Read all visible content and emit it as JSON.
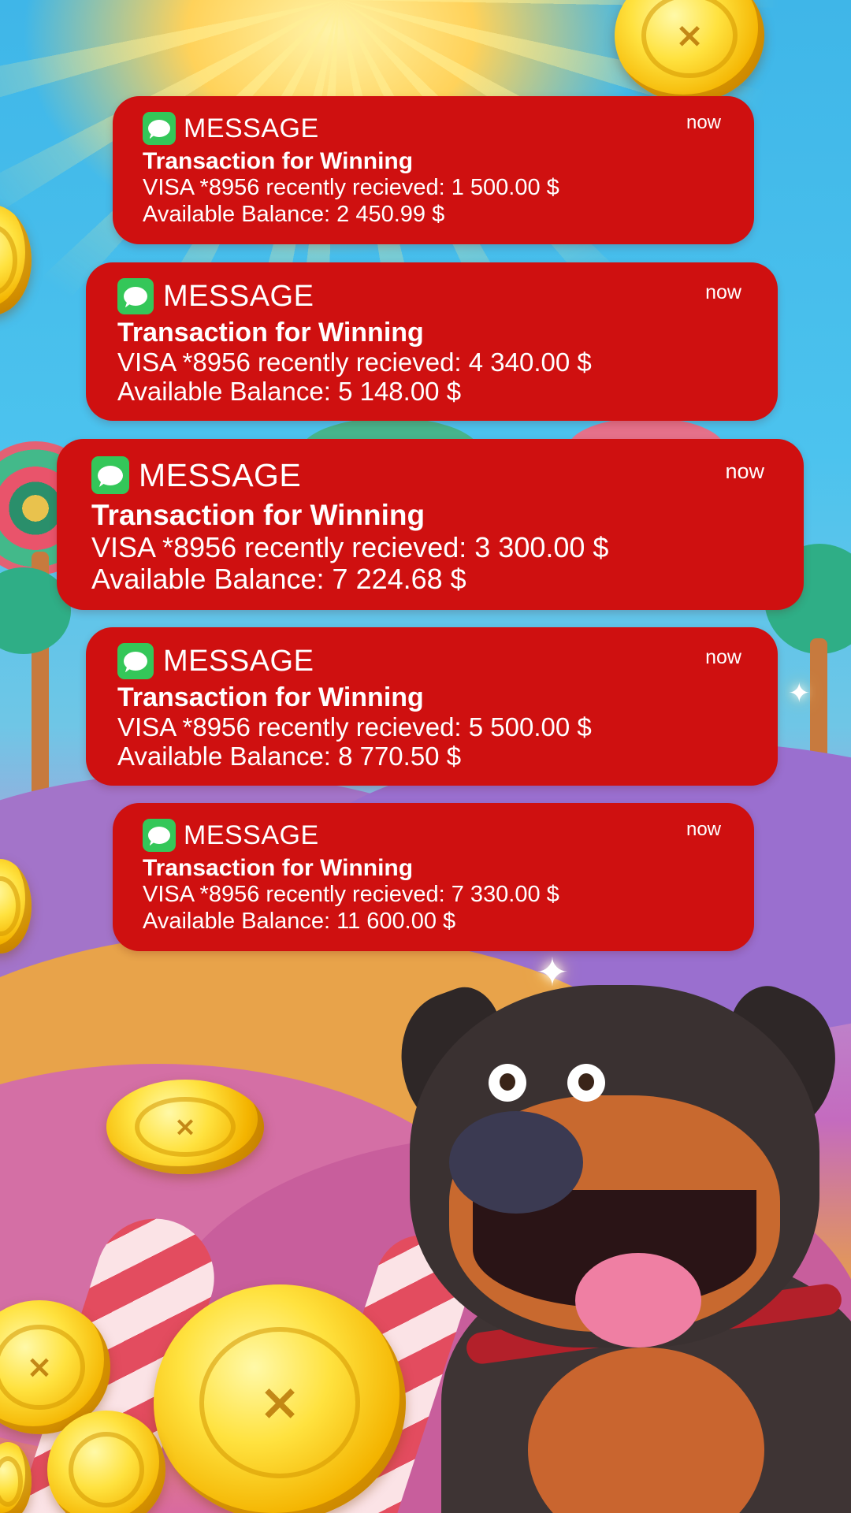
{
  "colors": {
    "notification_bg": "#cf1010",
    "app_icon_green": "#34c759",
    "text": "#ffffff"
  },
  "notifications": [
    {
      "app_name": "MESSAGE",
      "app_icon": "messages-bubble-icon",
      "time": "now",
      "title": "Transaction for Winning",
      "line1": "VISA *8956 recently recieved: 1 500.00 $",
      "line2": "Available Balance: 2 450.99 $"
    },
    {
      "app_name": "MESSAGE",
      "app_icon": "messages-bubble-icon",
      "time": "now",
      "title": "Transaction for Winning",
      "line1": "VISA *8956 recently recieved: 4 340.00 $",
      "line2": "Available Balance: 5 148.00 $"
    },
    {
      "app_name": "MESSAGE",
      "app_icon": "messages-bubble-icon",
      "time": "now",
      "title": "Transaction for Winning",
      "line1": "VISA *8956 recently recieved: 3 300.00 $",
      "line2": "Available Balance: 7 224.68 $"
    },
    {
      "app_name": "MESSAGE",
      "app_icon": "messages-bubble-icon",
      "time": "now",
      "title": "Transaction for Winning",
      "line1": "VISA *8956 recently recieved: 5 500.00 $",
      "line2": "Available Balance: 8 770.50 $"
    },
    {
      "app_name": "MESSAGE",
      "app_icon": "messages-bubble-icon",
      "time": "now",
      "title": "Transaction for Winning",
      "line1": "VISA *8956 recently recieved: 7 330.00 $",
      "line2": "Available Balance: 11  600.00 $"
    }
  ],
  "background": {
    "coin_icon": "coin-icon",
    "mascot": "dog-mascot",
    "coin_mark": "×",
    "sparkle": "✦"
  }
}
